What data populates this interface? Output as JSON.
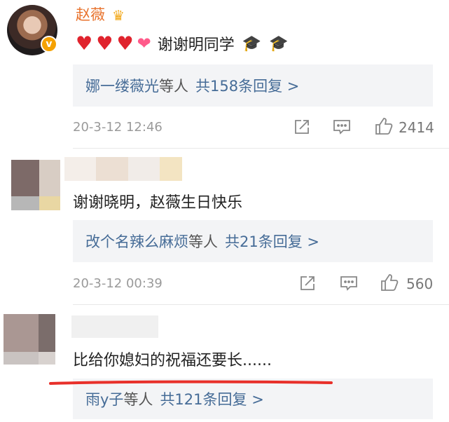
{
  "comment1": {
    "username": "赵薇",
    "text": "谢谢明同学",
    "replies": {
      "names": "娜一缕薇光",
      "others": "等人",
      "count": "共158条回复 >"
    },
    "time": "20-3-12 12:46",
    "likes": "2414"
  },
  "comment2": {
    "text": "谢谢晓明，赵薇生日快乐",
    "replies": {
      "names": "改个名辣么麻烦",
      "others": "等人",
      "count": "共21条回复 >"
    },
    "time": "20-3-12 00:39",
    "likes": "560"
  },
  "comment3": {
    "text": "比给你媳妇的祝福还要长......",
    "replies": {
      "names": "雨y子",
      "others": "等人",
      "count": "共121条回复 >"
    }
  },
  "colors": {
    "accent": "#e8722c",
    "link": "#466c97",
    "annotation": "#e8302a"
  },
  "icons": [
    "verified-badge-icon",
    "crown-icon",
    "heart-icon",
    "sparkling-heart-icon",
    "graduate-icon",
    "share-icon",
    "comment-icon",
    "like-icon"
  ]
}
